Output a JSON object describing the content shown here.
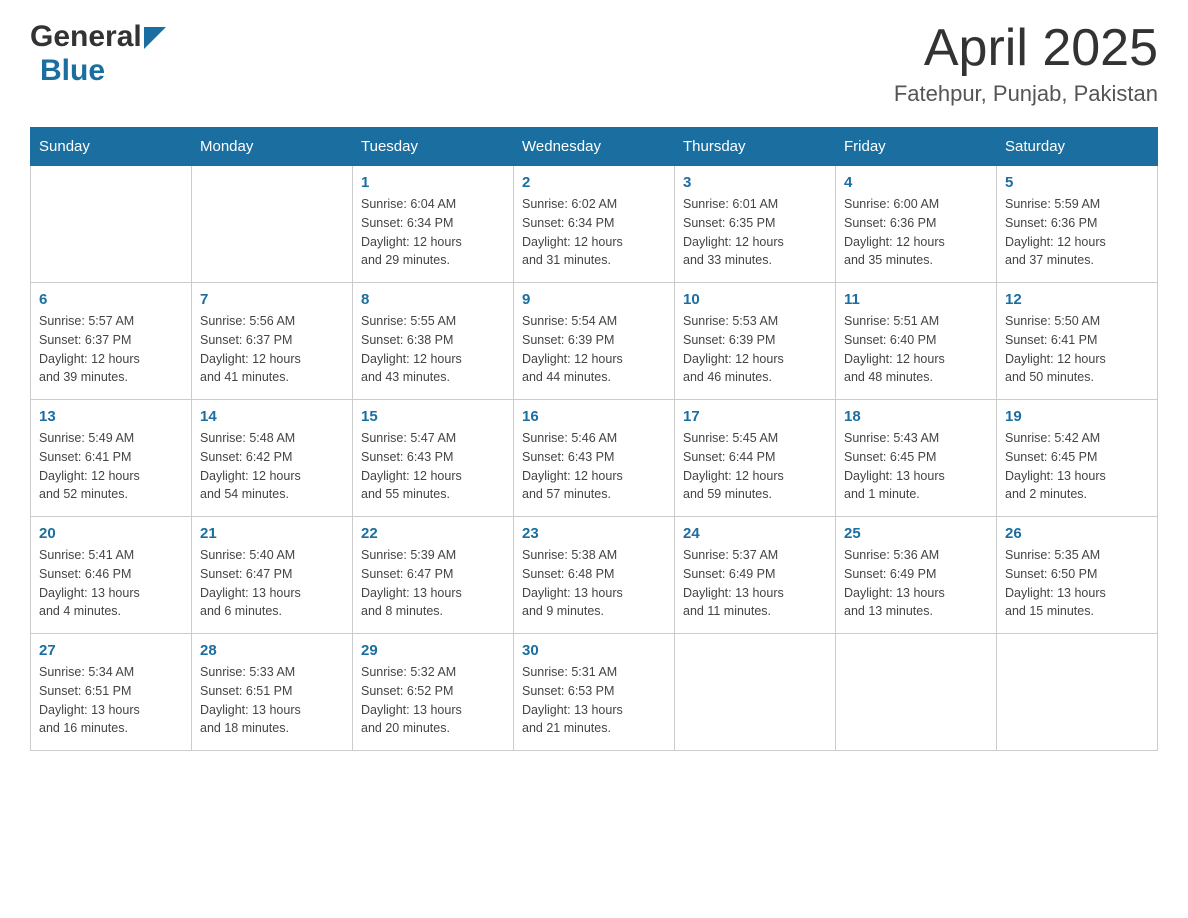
{
  "header": {
    "logo_text_general": "General",
    "logo_text_blue": "Blue",
    "title": "April 2025",
    "subtitle": "Fatehpur, Punjab, Pakistan"
  },
  "days_of_week": [
    "Sunday",
    "Monday",
    "Tuesday",
    "Wednesday",
    "Thursday",
    "Friday",
    "Saturday"
  ],
  "weeks": [
    [
      {
        "day": "",
        "info": ""
      },
      {
        "day": "",
        "info": ""
      },
      {
        "day": "1",
        "info": "Sunrise: 6:04 AM\nSunset: 6:34 PM\nDaylight: 12 hours\nand 29 minutes."
      },
      {
        "day": "2",
        "info": "Sunrise: 6:02 AM\nSunset: 6:34 PM\nDaylight: 12 hours\nand 31 minutes."
      },
      {
        "day": "3",
        "info": "Sunrise: 6:01 AM\nSunset: 6:35 PM\nDaylight: 12 hours\nand 33 minutes."
      },
      {
        "day": "4",
        "info": "Sunrise: 6:00 AM\nSunset: 6:36 PM\nDaylight: 12 hours\nand 35 minutes."
      },
      {
        "day": "5",
        "info": "Sunrise: 5:59 AM\nSunset: 6:36 PM\nDaylight: 12 hours\nand 37 minutes."
      }
    ],
    [
      {
        "day": "6",
        "info": "Sunrise: 5:57 AM\nSunset: 6:37 PM\nDaylight: 12 hours\nand 39 minutes."
      },
      {
        "day": "7",
        "info": "Sunrise: 5:56 AM\nSunset: 6:37 PM\nDaylight: 12 hours\nand 41 minutes."
      },
      {
        "day": "8",
        "info": "Sunrise: 5:55 AM\nSunset: 6:38 PM\nDaylight: 12 hours\nand 43 minutes."
      },
      {
        "day": "9",
        "info": "Sunrise: 5:54 AM\nSunset: 6:39 PM\nDaylight: 12 hours\nand 44 minutes."
      },
      {
        "day": "10",
        "info": "Sunrise: 5:53 AM\nSunset: 6:39 PM\nDaylight: 12 hours\nand 46 minutes."
      },
      {
        "day": "11",
        "info": "Sunrise: 5:51 AM\nSunset: 6:40 PM\nDaylight: 12 hours\nand 48 minutes."
      },
      {
        "day": "12",
        "info": "Sunrise: 5:50 AM\nSunset: 6:41 PM\nDaylight: 12 hours\nand 50 minutes."
      }
    ],
    [
      {
        "day": "13",
        "info": "Sunrise: 5:49 AM\nSunset: 6:41 PM\nDaylight: 12 hours\nand 52 minutes."
      },
      {
        "day": "14",
        "info": "Sunrise: 5:48 AM\nSunset: 6:42 PM\nDaylight: 12 hours\nand 54 minutes."
      },
      {
        "day": "15",
        "info": "Sunrise: 5:47 AM\nSunset: 6:43 PM\nDaylight: 12 hours\nand 55 minutes."
      },
      {
        "day": "16",
        "info": "Sunrise: 5:46 AM\nSunset: 6:43 PM\nDaylight: 12 hours\nand 57 minutes."
      },
      {
        "day": "17",
        "info": "Sunrise: 5:45 AM\nSunset: 6:44 PM\nDaylight: 12 hours\nand 59 minutes."
      },
      {
        "day": "18",
        "info": "Sunrise: 5:43 AM\nSunset: 6:45 PM\nDaylight: 13 hours\nand 1 minute."
      },
      {
        "day": "19",
        "info": "Sunrise: 5:42 AM\nSunset: 6:45 PM\nDaylight: 13 hours\nand 2 minutes."
      }
    ],
    [
      {
        "day": "20",
        "info": "Sunrise: 5:41 AM\nSunset: 6:46 PM\nDaylight: 13 hours\nand 4 minutes."
      },
      {
        "day": "21",
        "info": "Sunrise: 5:40 AM\nSunset: 6:47 PM\nDaylight: 13 hours\nand 6 minutes."
      },
      {
        "day": "22",
        "info": "Sunrise: 5:39 AM\nSunset: 6:47 PM\nDaylight: 13 hours\nand 8 minutes."
      },
      {
        "day": "23",
        "info": "Sunrise: 5:38 AM\nSunset: 6:48 PM\nDaylight: 13 hours\nand 9 minutes."
      },
      {
        "day": "24",
        "info": "Sunrise: 5:37 AM\nSunset: 6:49 PM\nDaylight: 13 hours\nand 11 minutes."
      },
      {
        "day": "25",
        "info": "Sunrise: 5:36 AM\nSunset: 6:49 PM\nDaylight: 13 hours\nand 13 minutes."
      },
      {
        "day": "26",
        "info": "Sunrise: 5:35 AM\nSunset: 6:50 PM\nDaylight: 13 hours\nand 15 minutes."
      }
    ],
    [
      {
        "day": "27",
        "info": "Sunrise: 5:34 AM\nSunset: 6:51 PM\nDaylight: 13 hours\nand 16 minutes."
      },
      {
        "day": "28",
        "info": "Sunrise: 5:33 AM\nSunset: 6:51 PM\nDaylight: 13 hours\nand 18 minutes."
      },
      {
        "day": "29",
        "info": "Sunrise: 5:32 AM\nSunset: 6:52 PM\nDaylight: 13 hours\nand 20 minutes."
      },
      {
        "day": "30",
        "info": "Sunrise: 5:31 AM\nSunset: 6:53 PM\nDaylight: 13 hours\nand 21 minutes."
      },
      {
        "day": "",
        "info": ""
      },
      {
        "day": "",
        "info": ""
      },
      {
        "day": "",
        "info": ""
      }
    ]
  ],
  "accent_color": "#1a6fa0"
}
